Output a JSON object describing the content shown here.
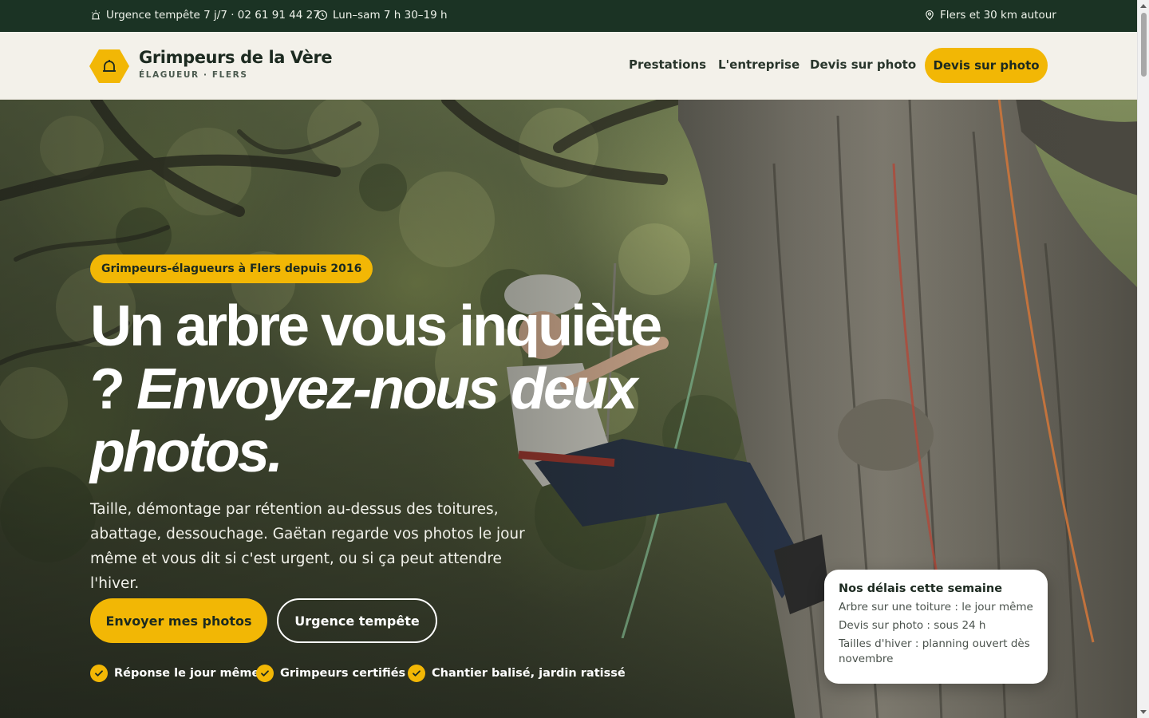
{
  "topbar": {
    "emergency": "Urgence tempête 7 j/7 · 02 61 91 44 27",
    "hours": "Lun–sam 7 h 30–19 h",
    "area": "Flers et 30 km autour"
  },
  "brand": {
    "name": "Grimpeurs de la Vère",
    "subtitle": "ÉLAGUEUR · FLERS"
  },
  "nav": {
    "items": [
      "Prestations",
      "L'entreprise",
      "Devis sur photo"
    ],
    "cta": "Devis sur photo"
  },
  "hero": {
    "badge": "Grimpeurs-élagueurs à Flers depuis 2016",
    "title_plain": "Un arbre vous inquiète ?",
    "title_em": "Envoyez-nous deux photos.",
    "lead": "Taille, démontage par rétention au-dessus des toitures, abattage, dessouchage. Gaëtan regarde vos photos le jour même et vous dit si c'est urgent, ou si ça peut attendre l'hiver.",
    "primary_button": "Envoyer mes photos",
    "secondary_button": "Urgence tempête",
    "trust": [
      "Réponse le jour même",
      "Grimpeurs certifiés",
      "Chantier balisé, jardin ratissé"
    ]
  },
  "delays": {
    "title": "Nos délais cette semaine",
    "lines": [
      "Arbre sur une toiture : le jour même",
      "Devis sur photo : sous 24 h",
      "Tailles d'hiver : planning ouvert dès novembre"
    ]
  },
  "colors": {
    "accent": "#f2b705",
    "topbar": "#1b3324",
    "header_bg": "#f3f1ea",
    "text_dark": "#1c2a20"
  },
  "icons": {
    "emergency": "alarm-light-icon",
    "hours": "clock-icon",
    "area": "map-pin-icon",
    "logo": "hexagon-bell-logo",
    "check": "check-icon"
  }
}
